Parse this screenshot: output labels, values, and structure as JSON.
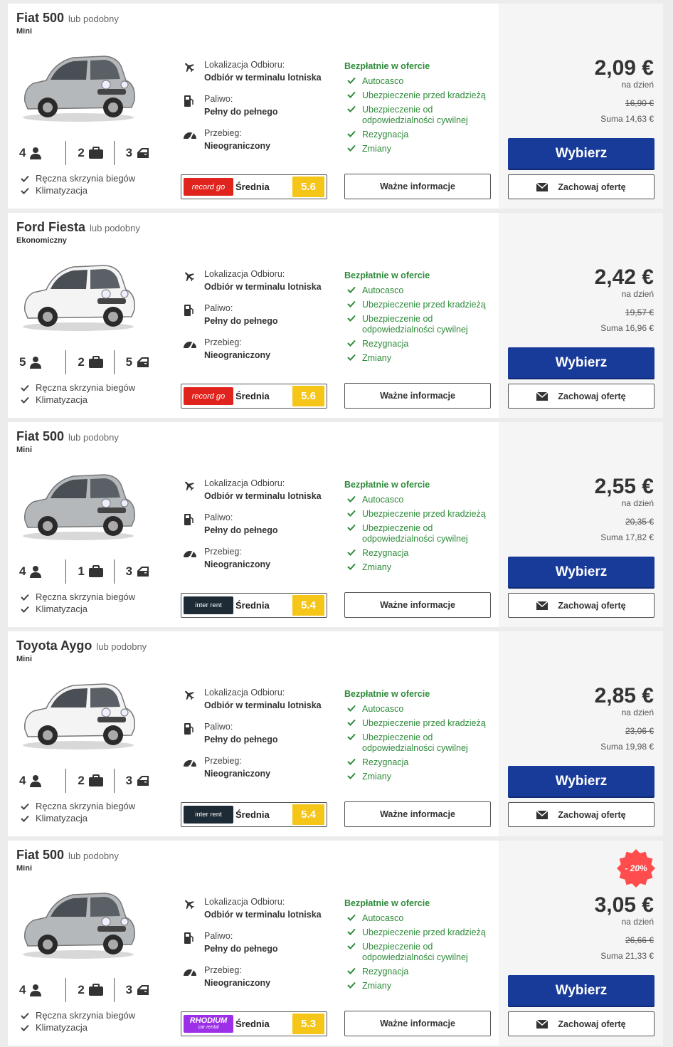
{
  "labels": {
    "similar": "lub podobny",
    "pickup_label": "Lokalizacja Odbioru:",
    "pickup_value": "Odbiór w terminalu lotniska",
    "fuel_label": "Paliwo:",
    "fuel_value": "Pełny do pełnego",
    "mileage_label": "Przebieg:",
    "mileage_value": "Nieograniczony",
    "rating_label": "Średnia",
    "free_header": "Bezpłatnie w ofercie",
    "free_items": [
      "Autocasco",
      "Ubezpieczenie przed kradzieżą",
      "Ubezpieczenie od odpowiedzialności cywilnej",
      "Rezygnacja",
      "Zmiany"
    ],
    "info_button": "Ważne informacje",
    "per_day": "na dzień",
    "choose_button": "Wybierz",
    "save_button": "Zachowaj ofertę",
    "features": [
      "Ręczna skrzynia biegów",
      "Klimatyzacja"
    ]
  },
  "colors": {
    "primary": "#183a99",
    "green": "#2e8b3a",
    "score": "#f5c518",
    "discount": "#ff4d4d"
  },
  "offers": [
    {
      "name": "Fiat 500",
      "category": "Mini",
      "seats": "4",
      "bags": "2",
      "doors": "3",
      "car_color": "silver",
      "supplier": "recordgo",
      "supplier_logo": "record go",
      "score": "5.6",
      "price": "2,09 €",
      "old_price": "16,90 €",
      "total": "Suma 14,63 €"
    },
    {
      "name": "Ford Fiesta",
      "category": "Ekonomiczny",
      "seats": "5",
      "bags": "2",
      "doors": "5",
      "car_color": "white",
      "supplier": "recordgo",
      "supplier_logo": "record go",
      "score": "5.6",
      "price": "2,42 €",
      "old_price": "19,57 €",
      "total": "Suma 16,96 €"
    },
    {
      "name": "Fiat 500",
      "category": "Mini",
      "seats": "4",
      "bags": "1",
      "doors": "3",
      "car_color": "silver",
      "supplier": "interrent",
      "supplier_logo": "inter rent",
      "score": "5.4",
      "price": "2,55 €",
      "old_price": "20,35 €",
      "total": "Suma 17,82 €"
    },
    {
      "name": "Toyota Aygo",
      "category": "Mini",
      "seats": "4",
      "bags": "2",
      "doors": "3",
      "car_color": "white",
      "supplier": "interrent",
      "supplier_logo": "inter rent",
      "score": "5.4",
      "price": "2,85 €",
      "old_price": "23,06 €",
      "total": "Suma 19,98 €"
    },
    {
      "name": "Fiat 500",
      "category": "Mini",
      "seats": "4",
      "bags": "2",
      "doors": "3",
      "car_color": "silver",
      "supplier": "rhodium",
      "supplier_logo": "RHODIUM",
      "supplier_logo_sub": "car rental",
      "score": "5.3",
      "price": "3,05 €",
      "old_price": "26,66 €",
      "total": "Suma 21,33 €",
      "discount": "- 20%"
    }
  ]
}
